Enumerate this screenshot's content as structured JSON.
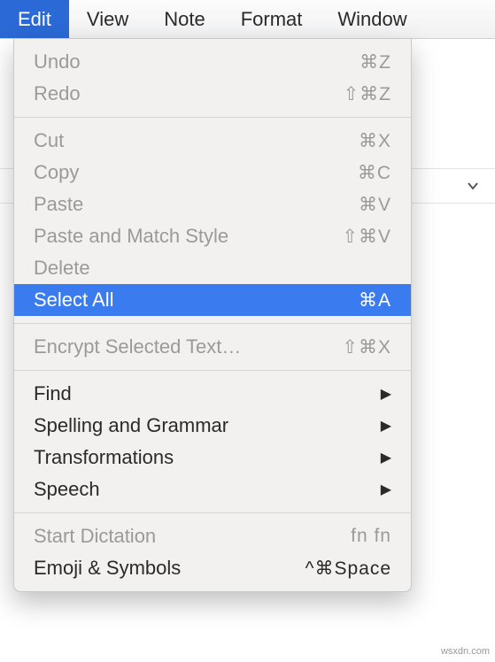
{
  "menubar": {
    "items": [
      {
        "label": "Edit",
        "active": true
      },
      {
        "label": "View",
        "active": false
      },
      {
        "label": "Note",
        "active": false
      },
      {
        "label": "Format",
        "active": false
      },
      {
        "label": "Window",
        "active": false
      }
    ]
  },
  "dropdown": {
    "groups": [
      [
        {
          "label": "Undo",
          "shortcut": "⌘Z",
          "disabled": true
        },
        {
          "label": "Redo",
          "shortcut": "⇧⌘Z",
          "disabled": true
        }
      ],
      [
        {
          "label": "Cut",
          "shortcut": "⌘X",
          "disabled": true
        },
        {
          "label": "Copy",
          "shortcut": "⌘C",
          "disabled": true
        },
        {
          "label": "Paste",
          "shortcut": "⌘V",
          "disabled": true
        },
        {
          "label": "Paste and Match Style",
          "shortcut": "⇧⌘V",
          "disabled": true
        },
        {
          "label": "Delete",
          "shortcut": "",
          "disabled": true
        },
        {
          "label": "Select All",
          "shortcut": "⌘A",
          "disabled": false,
          "highlight": true
        }
      ],
      [
        {
          "label": "Encrypt Selected Text…",
          "shortcut": "⇧⌘X",
          "disabled": true
        }
      ],
      [
        {
          "label": "Find",
          "submenu": true,
          "disabled": false
        },
        {
          "label": "Spelling and Grammar",
          "submenu": true,
          "disabled": false
        },
        {
          "label": "Transformations",
          "submenu": true,
          "disabled": false
        },
        {
          "label": "Speech",
          "submenu": true,
          "disabled": false
        }
      ],
      [
        {
          "label": "Start Dictation",
          "shortcut": "fn fn",
          "disabled": true
        },
        {
          "label": "Emoji & Symbols",
          "shortcut": "^⌘Space",
          "disabled": false
        }
      ]
    ]
  },
  "watermark": "wsxdn.com"
}
